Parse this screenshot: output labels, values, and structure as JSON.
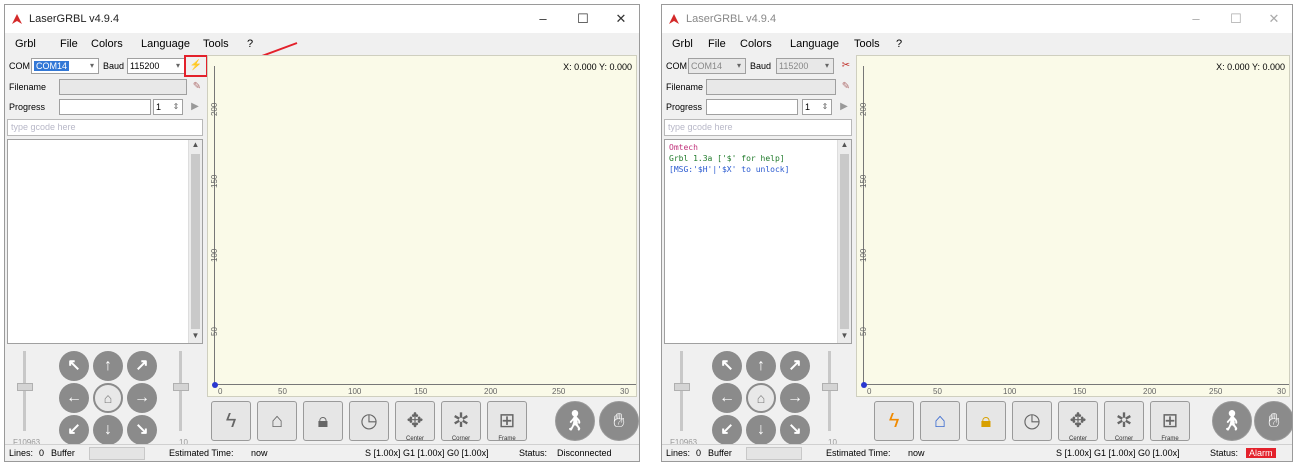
{
  "windows": [
    {
      "title": "LaserGRBL v4.9.4",
      "menu": [
        "Grbl",
        "File",
        "Colors",
        "Language",
        "Tools",
        "?"
      ],
      "com_label": "COM",
      "com_value": "COM14",
      "baud_label": "Baud",
      "baud_value": "115200",
      "filename_label": "Filename",
      "progress_label": "Progress",
      "progress_value": "1",
      "gcode_placeholder": "type gcode here",
      "log": [],
      "coords": "X: 0.000 Y: 0.000",
      "v_ticks": [
        "200",
        "150",
        "100",
        "50"
      ],
      "h_ticks": [
        "0",
        "50",
        "100",
        "150",
        "200",
        "250",
        "30"
      ],
      "jog_id": "F10963",
      "jog_speed": "10",
      "toolbar_captions": [
        "Center",
        "Corner",
        "Frame"
      ],
      "status": {
        "lines_label": "Lines:",
        "lines_value": "0",
        "buffer_label": "Buffer",
        "est_label": "Estimated Time:",
        "est_value": "now",
        "overrides": "S [1.00x] G1 [1.00x] G0 [1.00x]",
        "status_label": "Status:",
        "status_value": "Disconnected"
      }
    },
    {
      "title": "LaserGRBL v4.9.4",
      "menu": [
        "Grbl",
        "File",
        "Colors",
        "Language",
        "Tools",
        "?"
      ],
      "com_label": "COM",
      "com_value": "COM14",
      "baud_label": "Baud",
      "baud_value": "115200",
      "filename_label": "Filename",
      "progress_label": "Progress",
      "progress_value": "1",
      "gcode_placeholder": "type gcode here",
      "log": [
        "Omtech",
        "Grbl 1.3a ['$' for help]",
        "[MSG:'$H'|'$X' to unlock]"
      ],
      "log_colors": [
        "#c0307a",
        "#1f7a2a",
        "#2a5ad0"
      ],
      "coords": "X: 0.000 Y: 0.000",
      "v_ticks": [
        "200",
        "150",
        "100",
        "50"
      ],
      "h_ticks": [
        "0",
        "50",
        "100",
        "150",
        "200",
        "250",
        "30"
      ],
      "jog_id": "F10963",
      "jog_speed": "10",
      "toolbar_captions": [
        "Center",
        "Corner",
        "Frame"
      ],
      "status": {
        "lines_label": "Lines:",
        "lines_value": "0",
        "buffer_label": "Buffer",
        "est_label": "Estimated Time:",
        "est_value": "now",
        "overrides": "S [1.00x] G1 [1.00x] G0 [1.00x]",
        "status_label": "Status:",
        "status_value": "Alarm"
      }
    }
  ],
  "colors": {
    "canvas_bg": "#fafae8",
    "alarm": "#e3212b",
    "highlight": "#e3212b",
    "selection": "#3378d6"
  },
  "icons": [
    "laser-logo-icon",
    "connect-icon",
    "pencil-icon",
    "play-icon",
    "jog-arrow-icons",
    "home-icon",
    "lightning-icon",
    "lock-icon",
    "walk-icon",
    "hand-stop-icon"
  ]
}
